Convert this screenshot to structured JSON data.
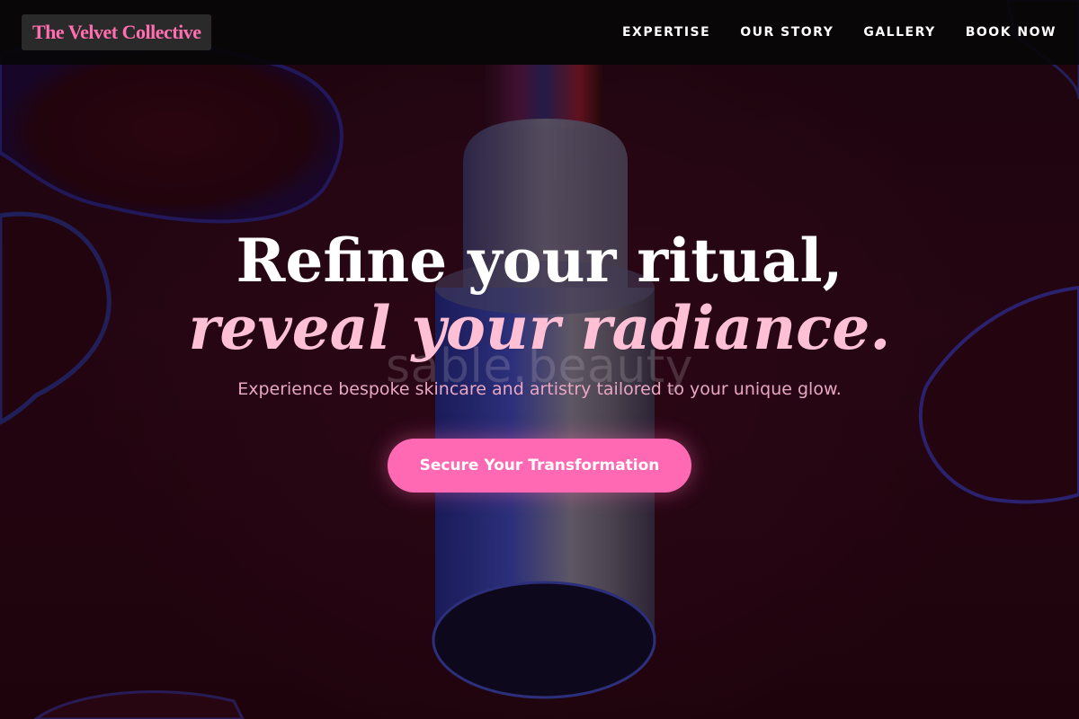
{
  "brand": {
    "name": "The Velvet Collective",
    "accent_color": "#ff69b4"
  },
  "nav": {
    "items": [
      {
        "label": "EXPERTISE"
      },
      {
        "label": "OUR STORY"
      },
      {
        "label": "GALLERY"
      },
      {
        "label": "BOOK NOW"
      }
    ]
  },
  "hero": {
    "background_image": "lipstick-product-photo",
    "watermark": "sable.beauty",
    "headline_line1": "Refine your ritual,",
    "headline_line2": "reveal your radiance.",
    "subheadline": "Experience bespoke skincare and artistry tailored to your unique glow.",
    "cta_label": "Secure Your Transformation"
  }
}
